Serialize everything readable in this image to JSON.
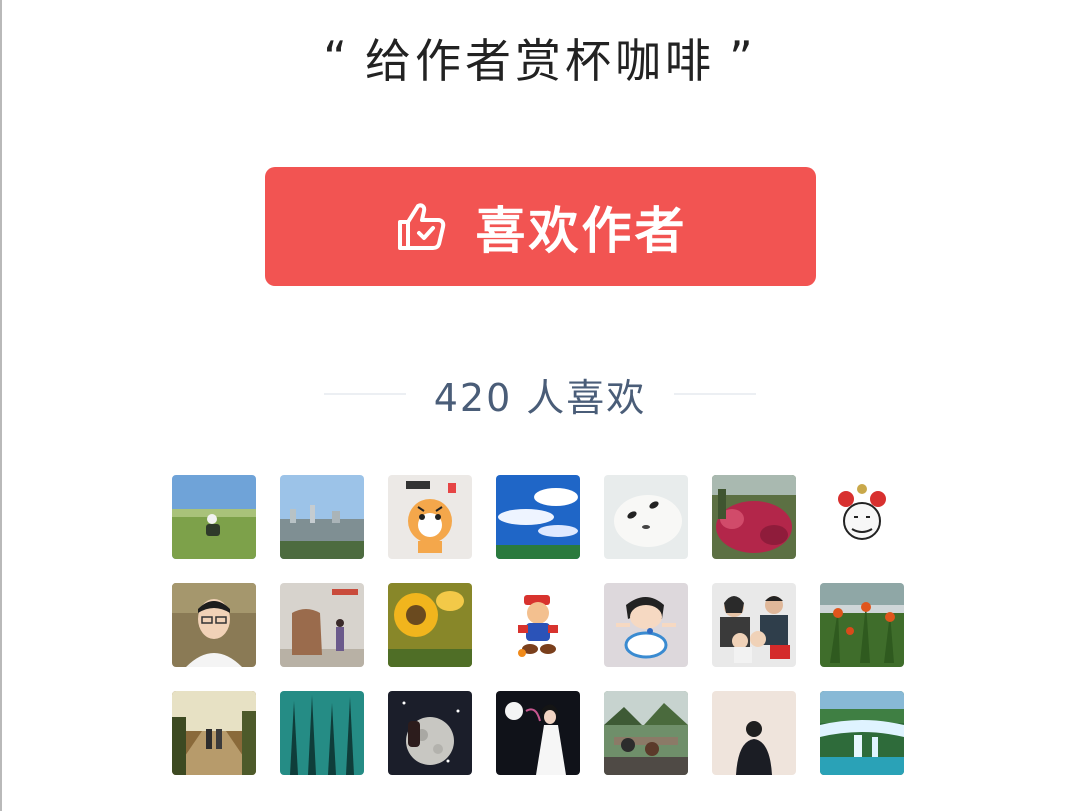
{
  "reward": {
    "open_quote": "“",
    "title": "给作者赏杯咖啡",
    "close_quote": "”"
  },
  "like_button": {
    "label": "喜欢作者",
    "icon": "thumbs-up-icon",
    "color": "#f25452"
  },
  "likes": {
    "count": "420",
    "suffix": "人喜欢"
  },
  "avatars": [
    {
      "name": "avatar-1",
      "depicts": "person sitting in grassland"
    },
    {
      "name": "avatar-2",
      "depicts": "city skyline"
    },
    {
      "name": "avatar-3",
      "depicts": "tiger cartoon"
    },
    {
      "name": "avatar-4",
      "depicts": "blue sky with clouds"
    },
    {
      "name": "avatar-5",
      "depicts": "baby seal"
    },
    {
      "name": "avatar-6",
      "depicts": "red flowers garden"
    },
    {
      "name": "avatar-7",
      "depicts": "cartoon face with headdress"
    },
    {
      "name": "avatar-8",
      "depicts": "man with glasses selfie"
    },
    {
      "name": "avatar-9",
      "depicts": "stone monument"
    },
    {
      "name": "avatar-10",
      "depicts": "sunflower"
    },
    {
      "name": "avatar-11",
      "depicts": "mario cartoon"
    },
    {
      "name": "avatar-12",
      "depicts": "crayon shin-chan cartoon"
    },
    {
      "name": "avatar-13",
      "depicts": "family photo"
    },
    {
      "name": "avatar-14",
      "depicts": "red flowers plants"
    },
    {
      "name": "avatar-15",
      "depicts": "couple walking on path"
    },
    {
      "name": "avatar-16",
      "depicts": "teal forest"
    },
    {
      "name": "avatar-17",
      "depicts": "moon portrait"
    },
    {
      "name": "avatar-18",
      "depicts": "woman in white dress at night"
    },
    {
      "name": "avatar-19",
      "depicts": "outdoor dining"
    },
    {
      "name": "avatar-20",
      "depicts": "person back view"
    },
    {
      "name": "avatar-21",
      "depicts": "waterfall"
    }
  ]
}
